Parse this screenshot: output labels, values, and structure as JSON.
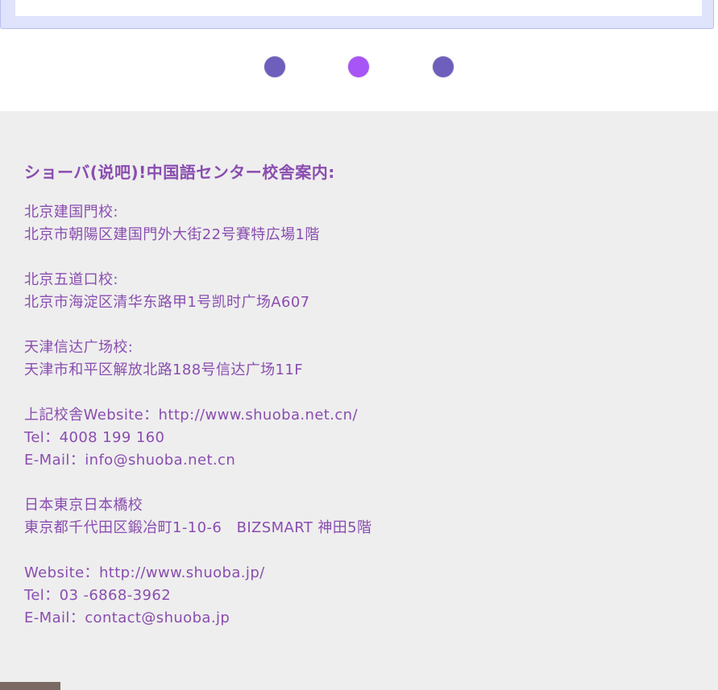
{
  "colors": {
    "text": "#8a4db0",
    "dot_inactive": "#6f5fbd",
    "dot_active": "#a855f7",
    "footer_bg": "#eeeeee"
  },
  "carousel": {
    "active_index": 1,
    "dot_count": 3
  },
  "footer": {
    "heading": "ショーバ(说吧)!中国語センター校舎案内:",
    "campuses": [
      {
        "lines": [
          "北京建国門校:",
          "北京市朝陽区建国門外大街22号賽特広場1階"
        ]
      },
      {
        "lines": [
          "北京五道口校:",
          "北京市海淀区清华东路甲1号凯时广场A607"
        ]
      },
      {
        "lines": [
          "天津信达广场校:",
          "天津市和平区解放北路188号信达广场11F"
        ]
      },
      {
        "lines": [
          "上記校舎Website：http://www.shuoba.net.cn/",
          "Tel：4008 199 160",
          "E-Mail：info@shuoba.net.cn"
        ]
      },
      {
        "lines": [
          "日本東京日本橋校",
          "東京都千代田区鍛冶町1-10-6　BIZSMART 神田5階"
        ]
      },
      {
        "lines": [
          "Website：http://www.shuoba.jp/",
          "Tel：03 -6868-3962",
          "E-Mail：contact@shuoba.jp"
        ]
      }
    ]
  }
}
